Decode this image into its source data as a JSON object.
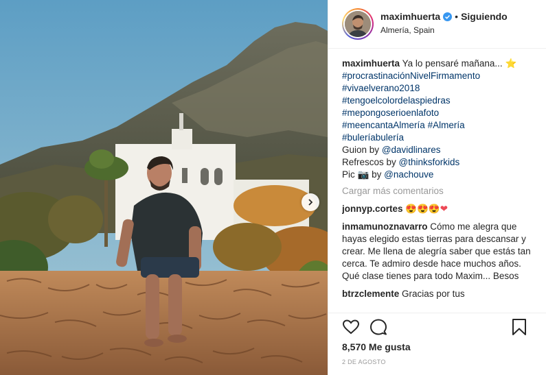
{
  "post": {
    "image_alt": "Man sitting on stone wall in front of white house and mountain",
    "next_icon": "chevron-right-icon"
  },
  "header": {
    "username": "maximhuerta",
    "verified_icon": "verified-badge-icon",
    "separator": "•",
    "follow_status": "Siguiendo",
    "location": "Almería, Spain"
  },
  "caption": {
    "username": "maximhuerta",
    "text": "Ya lo pensaré mañana...",
    "star": "⭐",
    "hashtags": [
      "#procrastinaciónNivelFirmamento",
      "#vivaelverano2018",
      "#tengoelcolordelaspiedras",
      "#mepongoserioenlafoto"
    ],
    "hashtag_line_a": "#meencantaAlmería",
    "hashtag_line_b": "#Almería",
    "hashtag_last": "#buleríabulería",
    "guion_prefix": "Guion by",
    "guion_mention": "@davidlinares",
    "refrescos_prefix": "Refrescos by",
    "refrescos_mention": "@thinksforkids",
    "pic_prefix": "Pic",
    "camera": "📷",
    "pic_by": "by",
    "pic_mention": "@nachouve"
  },
  "load_more": "Cargar más comentarios",
  "comments": [
    {
      "username": "jonnyp.cortes",
      "text": "😍😍😍❤"
    },
    {
      "username": "inmamunoznavarro",
      "text": "Cómo me alegra que hayas elegido estas tierras para descansar y crear. Me llena de alegría saber que estás tan cerca. Te admiro desde hace muchos años. Qué clase tienes para todo Maxim... Besos"
    },
    {
      "username": "btrzclemente",
      "text": "Gracias por tus"
    }
  ],
  "actions": {
    "like_icon": "heart-outline-icon",
    "comment_icon": "comment-bubble-icon",
    "save_icon": "bookmark-icon"
  },
  "likes": "8,570 Me gusta",
  "date": "2 DE AGOSTO",
  "colors": {
    "link": "#003569",
    "verified": "#3897f0",
    "muted": "#999999",
    "sky": "#7fb4d1"
  }
}
